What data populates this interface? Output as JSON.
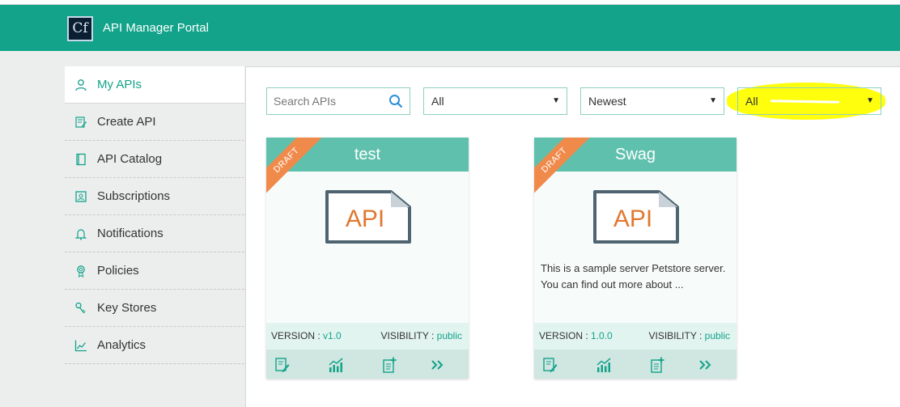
{
  "header": {
    "logo_text": "Cf",
    "title": "API Manager Portal"
  },
  "sidebar": {
    "items": [
      {
        "label": "My APIs",
        "icon": "user-icon",
        "active": true
      },
      {
        "label": "Create API",
        "icon": "edit-icon"
      },
      {
        "label": "API Catalog",
        "icon": "book-icon"
      },
      {
        "label": "Subscriptions",
        "icon": "contacts-icon"
      },
      {
        "label": "Notifications",
        "icon": "bell-icon"
      },
      {
        "label": "Policies",
        "icon": "badge-icon"
      },
      {
        "label": "Key Stores",
        "icon": "keys-icon"
      },
      {
        "label": "Analytics",
        "icon": "chart-icon"
      }
    ]
  },
  "toolbar": {
    "search_placeholder": "Search APIs",
    "filter1": "All",
    "filter2": "Newest",
    "filter3": "All"
  },
  "cards": [
    {
      "title": "test",
      "ribbon": "DRAFT",
      "image_text": "API",
      "description": "",
      "version_label": "VERSION :",
      "version": "v1.0",
      "visibility_label": "VISIBILITY :",
      "visibility": "public"
    },
    {
      "title": "Swag",
      "ribbon": "DRAFT",
      "image_text": "API",
      "description": "This is a sample server Petstore server. You can find out more about ...",
      "version_label": "VERSION :",
      "version": "1.0.0",
      "visibility_label": "VISIBILITY :",
      "visibility": "public"
    }
  ],
  "colors": {
    "brand": "#13a38a",
    "card_header": "#5fc1ad",
    "ribbon": "#f08a4b",
    "api_text": "#e0782f"
  }
}
